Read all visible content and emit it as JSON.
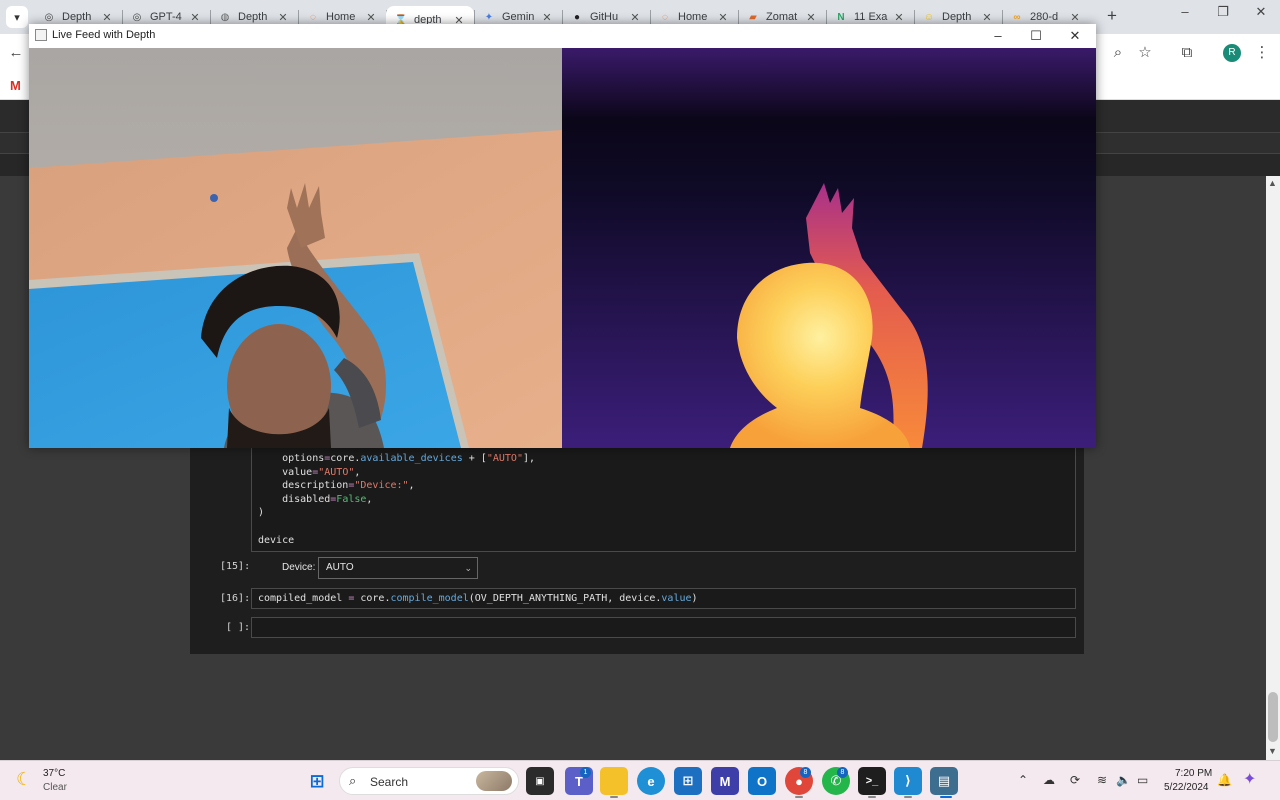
{
  "browser": {
    "tabs": [
      {
        "label": "Depth",
        "icon": "openai-icon"
      },
      {
        "label": "GPT-4",
        "icon": "openai-icon"
      },
      {
        "label": "Depth",
        "icon": "globe-icon"
      },
      {
        "label": "Home",
        "icon": "jupyter-icon"
      },
      {
        "label": "depth",
        "icon": "hourglass-icon",
        "active": true
      },
      {
        "label": "Gemin",
        "icon": "gemini-icon"
      },
      {
        "label": "GitHu",
        "icon": "github-icon"
      },
      {
        "label": "Home",
        "icon": "jupyter-icon"
      },
      {
        "label": "Zomat",
        "icon": "zomato-icon"
      },
      {
        "label": "11 Exa",
        "icon": "n-icon"
      },
      {
        "label": "Depth",
        "icon": "hugging-face-icon"
      },
      {
        "label": "280-d",
        "icon": "colab-icon"
      }
    ],
    "profile_initial": "R",
    "bookmark_gmail": "M"
  },
  "feed_window": {
    "title": "Live Feed with Depth"
  },
  "notebook": {
    "code_lines": [
      {
        "indent": "    ",
        "parts": [
          [
            "options",
            ""
          ],
          [
            "=",
            "op"
          ],
          [
            "core.",
            ""
          ],
          [
            "available_devices",
            "kw"
          ],
          [
            " + [",
            ""
          ],
          [
            "\"AUTO\"",
            "str"
          ],
          [
            "],",
            ""
          ]
        ]
      },
      {
        "indent": "    ",
        "parts": [
          [
            "value",
            ""
          ],
          [
            "=",
            "op"
          ],
          [
            "\"AUTO\"",
            "str"
          ],
          [
            ",",
            ""
          ]
        ]
      },
      {
        "indent": "    ",
        "parts": [
          [
            "description",
            ""
          ],
          [
            "=",
            "op"
          ],
          [
            "\"Device:\"",
            "str"
          ],
          [
            ",",
            ""
          ]
        ]
      },
      {
        "indent": "    ",
        "parts": [
          [
            "disabled",
            ""
          ],
          [
            "=",
            "op"
          ],
          [
            "False",
            "bool"
          ],
          [
            ",",
            ""
          ]
        ]
      },
      {
        "indent": "",
        "parts": [
          [
            ")",
            ""
          ]
        ]
      },
      {
        "indent": "",
        "parts": [
          [
            "",
            ""
          ]
        ]
      },
      {
        "indent": "",
        "parts": [
          [
            "device",
            ""
          ]
        ]
      }
    ],
    "prompt_15": "[15]:",
    "device_label": "Device:",
    "device_value": "AUTO",
    "prompt_16": "[16]:",
    "cell16_code": "compiled_model = core.compile_model(OV_DEPTH_ANYTHING_PATH, device.value)",
    "prompt_empty": "[ ]:"
  },
  "taskbar": {
    "temperature": "37°C",
    "condition": "Clear",
    "search_label": "Search",
    "time": "7:20 PM",
    "date": "5/22/2024",
    "teams_badge": "1",
    "chrome_badge": "8",
    "whatsapp_badge": "8"
  }
}
